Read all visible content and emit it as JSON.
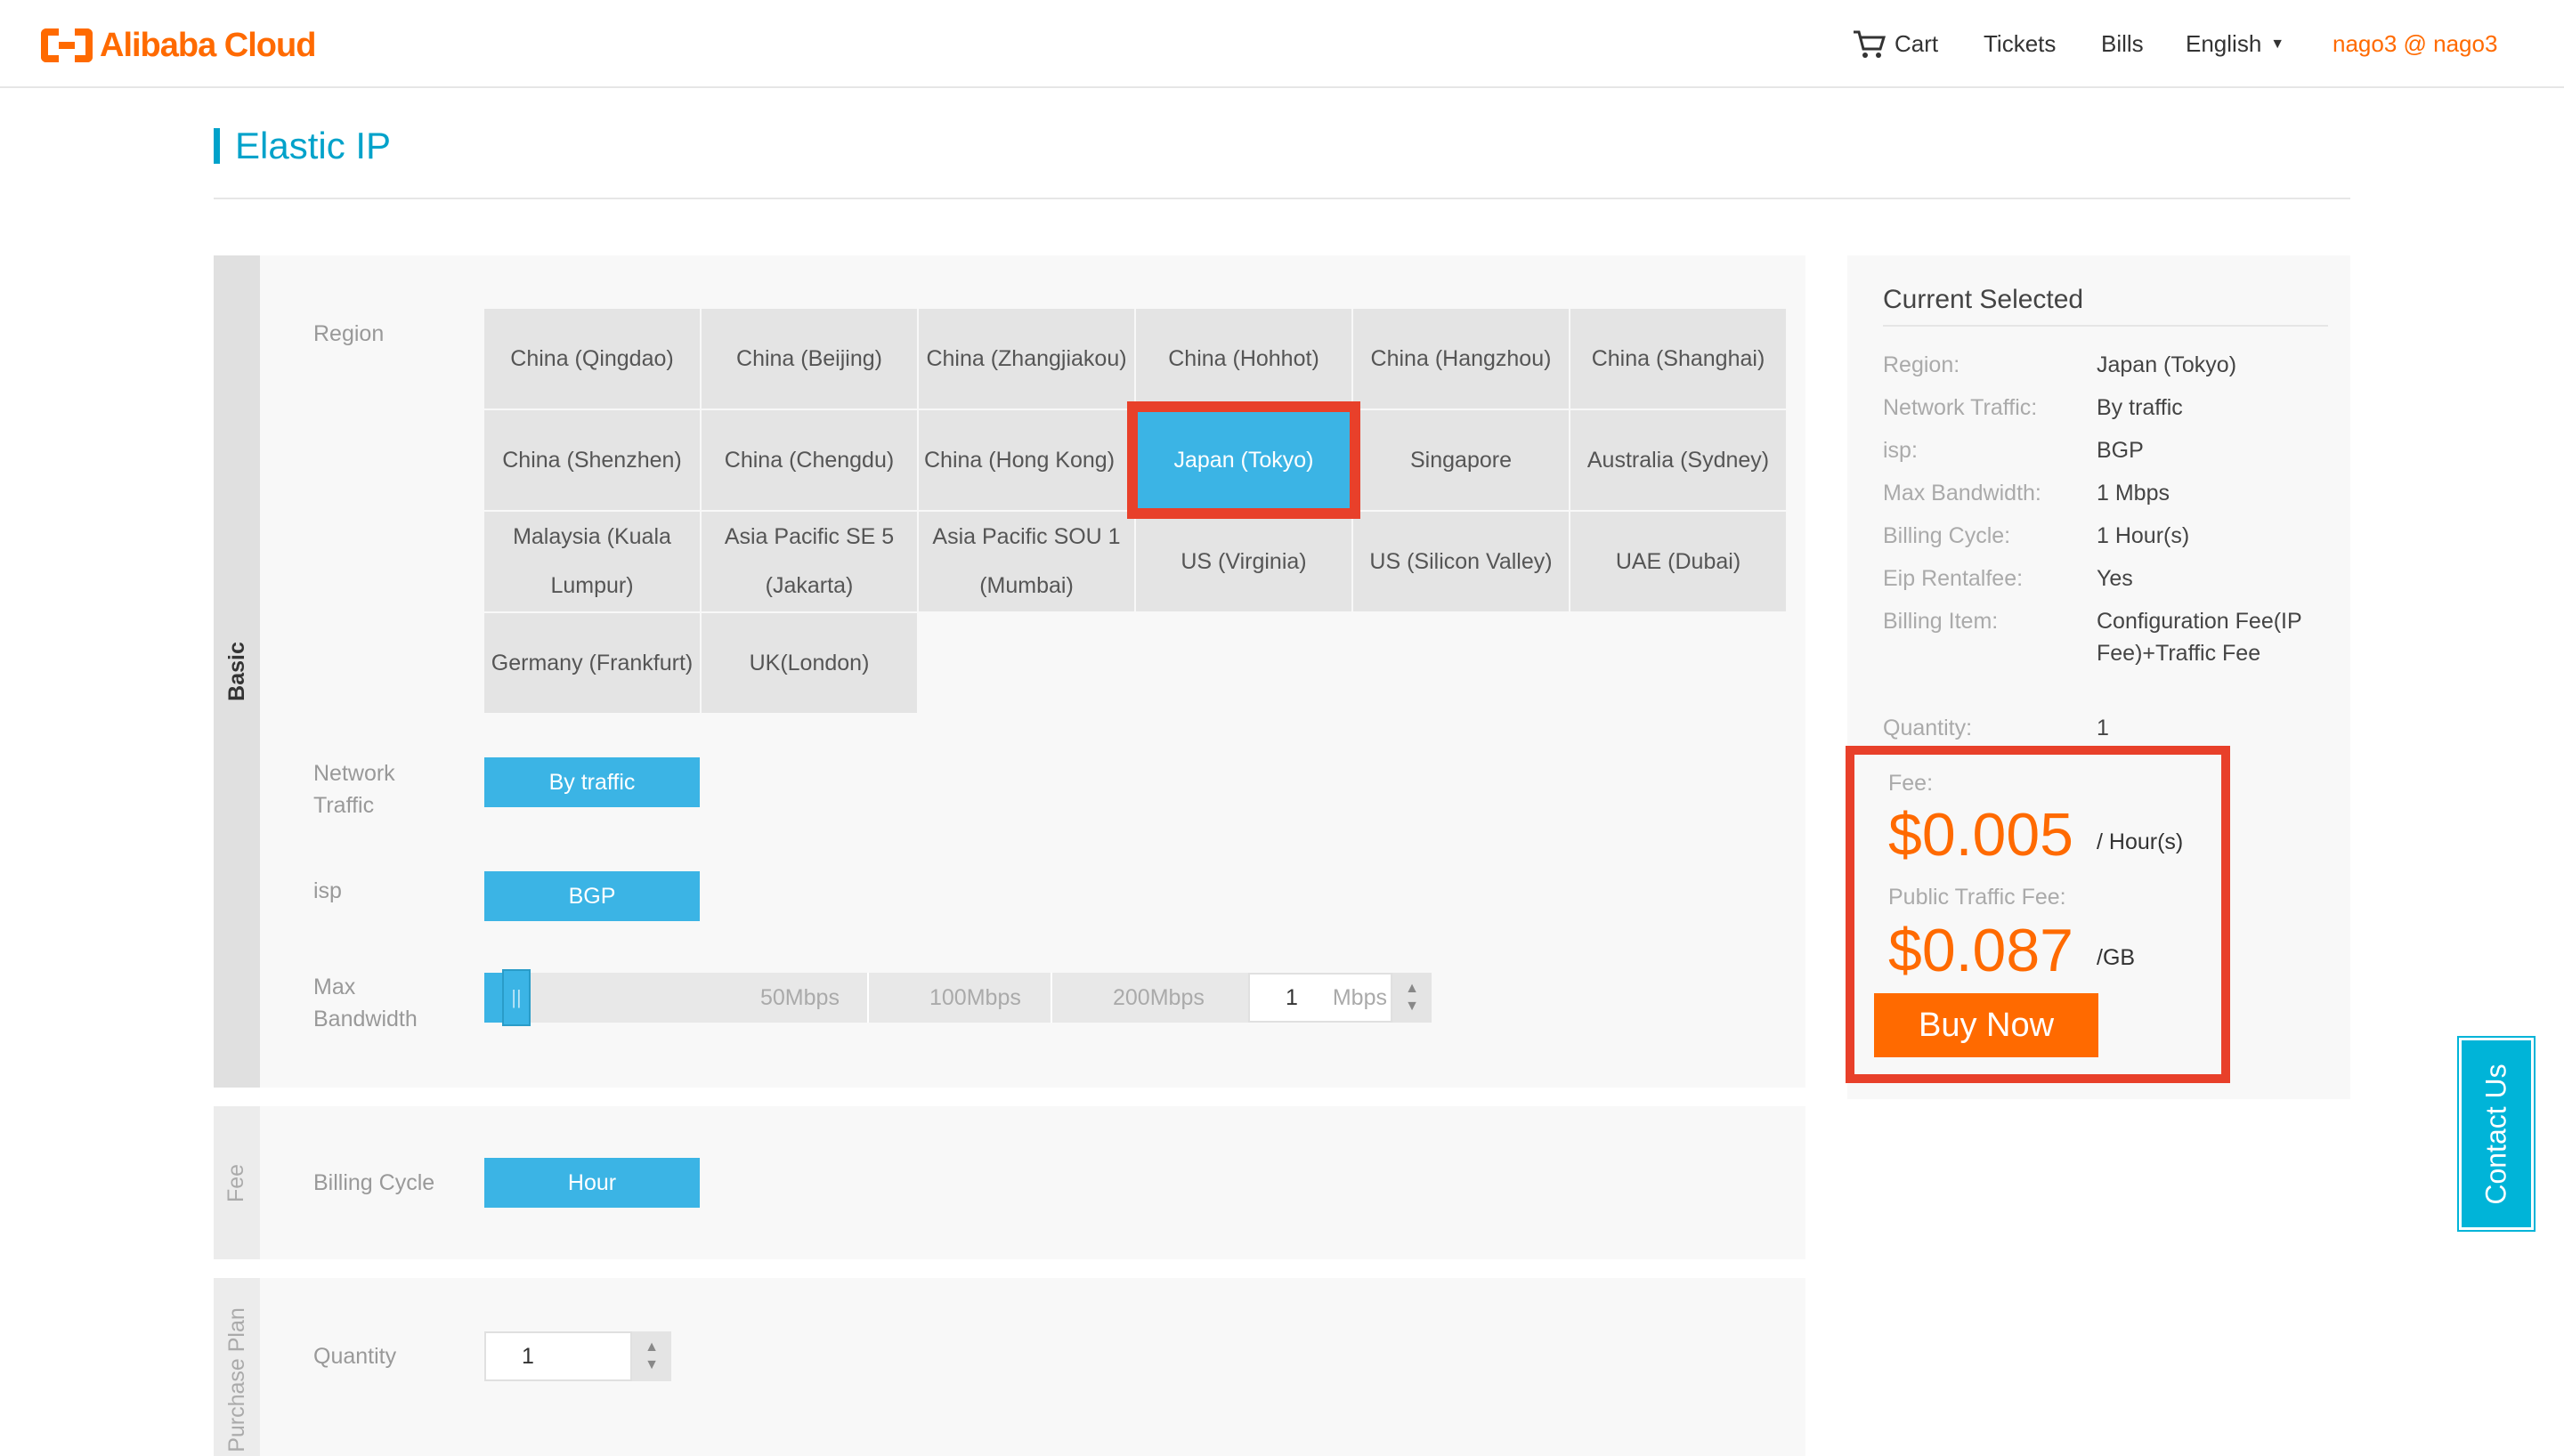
{
  "header": {
    "logo_text": "Alibaba Cloud",
    "nav": {
      "cart": "Cart",
      "tickets": "Tickets",
      "bills": "Bills",
      "language": "English",
      "user": "nago3 @ nago3"
    }
  },
  "page": {
    "title": "Elastic IP"
  },
  "sections": {
    "basic": "Basic",
    "fee": "Fee",
    "purchase_plan": "Purchase Plan"
  },
  "region": {
    "label": "Region",
    "selected": "Japan (Tokyo)",
    "options": [
      "China (Qingdao)",
      "China (Beijing)",
      "China (Zhangjiakou)",
      "China (Hohhot)",
      "China (Hangzhou)",
      "China (Shanghai)",
      "China (Shenzhen)",
      "China (Chengdu)",
      "China (Hong Kong)",
      "Japan (Tokyo)",
      "Singapore",
      "Australia (Sydney)",
      "Malaysia (Kuala Lumpur)",
      "Asia Pacific SE 5 (Jakarta)",
      "Asia Pacific SOU 1 (Mumbai)",
      "US (Virginia)",
      "US (Silicon Valley)",
      "UAE (Dubai)",
      "Germany (Frankfurt)",
      "UK(London)"
    ]
  },
  "network_traffic": {
    "label": "Network Traffic",
    "value": "By traffic"
  },
  "isp": {
    "label": "isp",
    "value": "BGP"
  },
  "max_bandwidth": {
    "label": "Max Bandwidth",
    "ticks": [
      "50Mbps",
      "100Mbps",
      "200Mbps"
    ],
    "value": "1",
    "unit": "Mbps",
    "fraction": 0.0
  },
  "billing_cycle": {
    "label": "Billing Cycle",
    "value": "Hour"
  },
  "quantity": {
    "label": "Quantity",
    "value": "1"
  },
  "summary": {
    "title": "Current Selected",
    "rows": [
      {
        "key": "Region:",
        "value": "Japan (Tokyo)"
      },
      {
        "key": "Network Traffic:",
        "value": "By traffic"
      },
      {
        "key": "isp:",
        "value": "BGP"
      },
      {
        "key": "Max Bandwidth:",
        "value": "1 Mbps"
      },
      {
        "key": "Billing Cycle:",
        "value": "1 Hour(s)"
      },
      {
        "key": "Eip Rentalfee:",
        "value": "Yes"
      },
      {
        "key": "Billing Item:",
        "value": "Configuration Fee(IP Fee)+Traffic Fee"
      },
      {
        "key": "Quantity:",
        "value": "1"
      }
    ],
    "fee_label": "Fee:",
    "fee_price": "$0.005",
    "fee_unit": "/ Hour(s)",
    "traffic_fee_label": "Public Traffic Fee:",
    "traffic_fee_price": "$0.087",
    "traffic_fee_unit": "/GB",
    "buy_label": "Buy Now"
  },
  "contact_us": "Contact Us",
  "colors": {
    "brand": "#ff6a00",
    "accent": "#3bb4e5",
    "highlight": "#e8402a"
  }
}
